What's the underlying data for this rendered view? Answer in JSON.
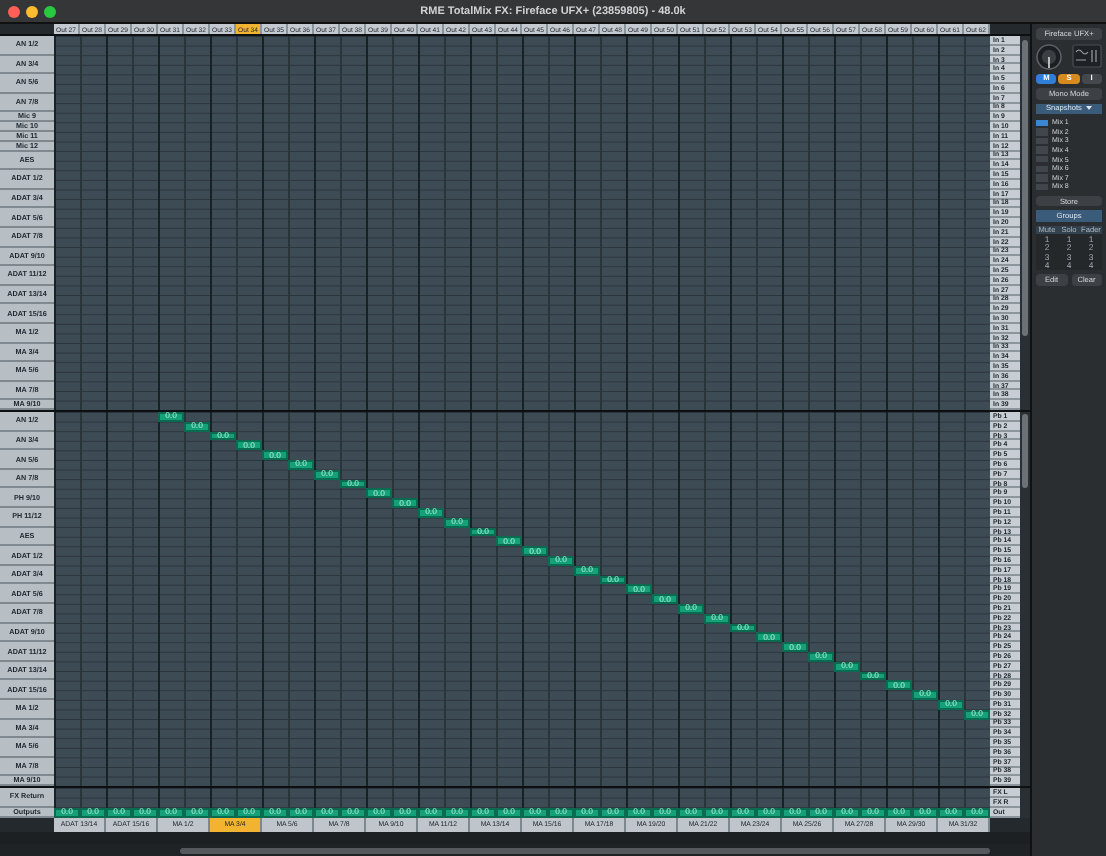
{
  "window": {
    "title": "RME TotalMix FX: Fireface UFX+ (23859805) - 48.0k"
  },
  "hardware_outputs": [
    {
      "label": "Out 27",
      "selected": false,
      "gain": "0.0"
    },
    {
      "label": "Out 28",
      "selected": false,
      "gain": "0.0"
    },
    {
      "label": "Out 29",
      "selected": false,
      "gain": "0.0"
    },
    {
      "label": "Out 30",
      "selected": false,
      "gain": "0.0"
    },
    {
      "label": "Out 31",
      "selected": false,
      "gain": "0.0"
    },
    {
      "label": "Out 32",
      "selected": false,
      "gain": "0.0"
    },
    {
      "label": "Out 33",
      "selected": false,
      "gain": "0.0"
    },
    {
      "label": "Out 34",
      "selected": true,
      "gain": "0.0"
    },
    {
      "label": "Out 35",
      "selected": false,
      "gain": "0.0"
    },
    {
      "label": "Out 36",
      "selected": false,
      "gain": "0.0"
    },
    {
      "label": "Out 37",
      "selected": false,
      "gain": "0.0"
    },
    {
      "label": "Out 38",
      "selected": false,
      "gain": "0.0"
    },
    {
      "label": "Out 39",
      "selected": false,
      "gain": "0.0"
    },
    {
      "label": "Out 40",
      "selected": false,
      "gain": "0.0"
    },
    {
      "label": "Out 41",
      "selected": false,
      "gain": "0.0"
    },
    {
      "label": "Out 42",
      "selected": false,
      "gain": "0.0"
    },
    {
      "label": "Out 43",
      "selected": false,
      "gain": "0.0"
    },
    {
      "label": "Out 44",
      "selected": false,
      "gain": "0.0"
    },
    {
      "label": "Out 45",
      "selected": false,
      "gain": "0.0"
    },
    {
      "label": "Out 46",
      "selected": false,
      "gain": "0.0"
    },
    {
      "label": "Out 47",
      "selected": false,
      "gain": "0.0"
    },
    {
      "label": "Out 48",
      "selected": false,
      "gain": "0.0"
    },
    {
      "label": "Out 49",
      "selected": false,
      "gain": "0.0"
    },
    {
      "label": "Out 50",
      "selected": false,
      "gain": "0.0"
    },
    {
      "label": "Out 51",
      "selected": false,
      "gain": "0.0"
    },
    {
      "label": "Out 52",
      "selected": false,
      "gain": "0.0"
    },
    {
      "label": "Out 53",
      "selected": false,
      "gain": "0.0"
    },
    {
      "label": "Out 54",
      "selected": false,
      "gain": "0.0"
    },
    {
      "label": "Out 55",
      "selected": false,
      "gain": "0.0"
    },
    {
      "label": "Out 56",
      "selected": false,
      "gain": "0.0"
    },
    {
      "label": "Out 57",
      "selected": false,
      "gain": "0.0"
    },
    {
      "label": "Out 58",
      "selected": false,
      "gain": "0.0"
    },
    {
      "label": "Out 59",
      "selected": false,
      "gain": "0.0"
    },
    {
      "label": "Out 60",
      "selected": false,
      "gain": "0.0"
    },
    {
      "label": "Out 61",
      "selected": false,
      "gain": "0.0"
    },
    {
      "label": "Out 62",
      "selected": false,
      "gain": "0.0"
    }
  ],
  "output_pairs": [
    {
      "label": "ADAT 13/14",
      "selected": false
    },
    {
      "label": "ADAT 15/16",
      "selected": false
    },
    {
      "label": "MA 1/2",
      "selected": false
    },
    {
      "label": "MA 3/4",
      "selected": true
    },
    {
      "label": "MA 5/6",
      "selected": false
    },
    {
      "label": "MA 7/8",
      "selected": false
    },
    {
      "label": "MA 9/10",
      "selected": false
    },
    {
      "label": "MA 11/12",
      "selected": false
    },
    {
      "label": "MA 13/14",
      "selected": false
    },
    {
      "label": "MA 15/16",
      "selected": false
    },
    {
      "label": "MA 17/18",
      "selected": false
    },
    {
      "label": "MA 19/20",
      "selected": false
    },
    {
      "label": "MA 21/22",
      "selected": false
    },
    {
      "label": "MA 23/24",
      "selected": false
    },
    {
      "label": "MA 25/26",
      "selected": false
    },
    {
      "label": "MA 27/28",
      "selected": false
    },
    {
      "label": "MA 29/30",
      "selected": false
    },
    {
      "label": "MA 31/32",
      "selected": false
    }
  ],
  "inputs": {
    "channels": [
      {
        "label": "AN 1/2",
        "kind": "stereo"
      },
      {
        "label": "AN 3/4",
        "kind": "stereo"
      },
      {
        "label": "AN 5/6",
        "kind": "stereo"
      },
      {
        "label": "AN 7/8",
        "kind": "stereo"
      },
      {
        "label": "Mic 9",
        "kind": "mono"
      },
      {
        "label": "Mic 10",
        "kind": "mono"
      },
      {
        "label": "Mic 11",
        "kind": "mono"
      },
      {
        "label": "Mic 12",
        "kind": "mono"
      },
      {
        "label": "AES",
        "kind": "stereo"
      },
      {
        "label": "ADAT 1/2",
        "kind": "stereo"
      },
      {
        "label": "ADAT 3/4",
        "kind": "stereo"
      },
      {
        "label": "ADAT 5/6",
        "kind": "stereo"
      },
      {
        "label": "ADAT 7/8",
        "kind": "stereo"
      },
      {
        "label": "ADAT 9/10",
        "kind": "stereo"
      },
      {
        "label": "ADAT 11/12",
        "kind": "stereo"
      },
      {
        "label": "ADAT 13/14",
        "kind": "stereo"
      },
      {
        "label": "ADAT 15/16",
        "kind": "stereo"
      },
      {
        "label": "MA 1/2",
        "kind": "stereo"
      },
      {
        "label": "MA 3/4",
        "kind": "stereo"
      },
      {
        "label": "MA 5/6",
        "kind": "stereo"
      },
      {
        "label": "MA 7/8",
        "kind": "stereo"
      },
      {
        "label": "MA 9/10",
        "kind": "mono"
      }
    ],
    "rows": [
      {
        "label": "In 1"
      },
      {
        "label": "In 2"
      },
      {
        "label": "In 3"
      },
      {
        "label": "In 4"
      },
      {
        "label": "In 5"
      },
      {
        "label": "In 6"
      },
      {
        "label": "In 7"
      },
      {
        "label": "In 8"
      },
      {
        "label": "In 9"
      },
      {
        "label": "In 10"
      },
      {
        "label": "In 11"
      },
      {
        "label": "In 12"
      },
      {
        "label": "In 13"
      },
      {
        "label": "In 14"
      },
      {
        "label": "In 15"
      },
      {
        "label": "In 16"
      },
      {
        "label": "In 17"
      },
      {
        "label": "In 18"
      },
      {
        "label": "In 19"
      },
      {
        "label": "In 20"
      },
      {
        "label": "In 21"
      },
      {
        "label": "In 22"
      },
      {
        "label": "In 23"
      },
      {
        "label": "In 24"
      },
      {
        "label": "In 25"
      },
      {
        "label": "In 26"
      },
      {
        "label": "In 27"
      },
      {
        "label": "In 28"
      },
      {
        "label": "In 29"
      },
      {
        "label": "In 30"
      },
      {
        "label": "In 31"
      },
      {
        "label": "In 32"
      },
      {
        "label": "In 33"
      },
      {
        "label": "In 34"
      },
      {
        "label": "In 35"
      },
      {
        "label": "In 36"
      },
      {
        "label": "In 37"
      },
      {
        "label": "In 38"
      },
      {
        "label": "In 39"
      }
    ]
  },
  "playback": {
    "channels": [
      {
        "label": "AN 1/2",
        "kind": "stereo"
      },
      {
        "label": "AN 3/4",
        "kind": "stereo"
      },
      {
        "label": "AN 5/6",
        "kind": "stereo"
      },
      {
        "label": "AN 7/8",
        "kind": "stereo"
      },
      {
        "label": "PH 9/10",
        "kind": "stereo"
      },
      {
        "label": "PH 11/12",
        "kind": "stereo"
      },
      {
        "label": "AES",
        "kind": "stereo"
      },
      {
        "label": "ADAT 1/2",
        "kind": "stereo"
      },
      {
        "label": "ADAT 3/4",
        "kind": "stereo"
      },
      {
        "label": "ADAT 5/6",
        "kind": "stereo"
      },
      {
        "label": "ADAT 7/8",
        "kind": "stereo"
      },
      {
        "label": "ADAT 9/10",
        "kind": "stereo"
      },
      {
        "label": "ADAT 11/12",
        "kind": "stereo"
      },
      {
        "label": "ADAT 13/14",
        "kind": "stereo"
      },
      {
        "label": "ADAT 15/16",
        "kind": "stereo"
      },
      {
        "label": "MA 1/2",
        "kind": "stereo"
      },
      {
        "label": "MA 3/4",
        "kind": "stereo"
      },
      {
        "label": "MA 5/6",
        "kind": "stereo"
      },
      {
        "label": "MA 7/8",
        "kind": "stereo"
      },
      {
        "label": "MA 9/10",
        "kind": "mono"
      }
    ],
    "rows": [
      {
        "label": "Pb 1",
        "gain": "0.0"
      },
      {
        "label": "Pb 2",
        "gain": "0.0"
      },
      {
        "label": "Pb 3",
        "gain": "0.0"
      },
      {
        "label": "Pb 4",
        "gain": "0.0"
      },
      {
        "label": "Pb 5",
        "gain": "0.0"
      },
      {
        "label": "Pb 6",
        "gain": "0.0"
      },
      {
        "label": "Pb 7",
        "gain": "0.0"
      },
      {
        "label": "Pb 8",
        "gain": "0.0"
      },
      {
        "label": "Pb 9",
        "gain": "0.0"
      },
      {
        "label": "Pb 10",
        "gain": "0.0"
      },
      {
        "label": "Pb 11",
        "gain": "0.0"
      },
      {
        "label": "Pb 12",
        "gain": "0.0"
      },
      {
        "label": "Pb 13",
        "gain": "0.0"
      },
      {
        "label": "Pb 14",
        "gain": "0.0"
      },
      {
        "label": "Pb 15",
        "gain": "0.0"
      },
      {
        "label": "Pb 16",
        "gain": "0.0"
      },
      {
        "label": "Pb 17",
        "gain": "0.0"
      },
      {
        "label": "Pb 18",
        "gain": "0.0"
      },
      {
        "label": "Pb 19",
        "gain": "0.0"
      },
      {
        "label": "Pb 20",
        "gain": "0.0"
      },
      {
        "label": "Pb 21",
        "gain": "0.0"
      },
      {
        "label": "Pb 22",
        "gain": "0.0"
      },
      {
        "label": "Pb 23",
        "gain": "0.0"
      },
      {
        "label": "Pb 24",
        "gain": "0.0"
      },
      {
        "label": "Pb 25",
        "gain": "0.0"
      },
      {
        "label": "Pb 26",
        "gain": "0.0"
      },
      {
        "label": "Pb 27",
        "gain": "0.0"
      },
      {
        "label": "Pb 28",
        "gain": "0.0"
      },
      {
        "label": "Pb 29",
        "gain": "0.0"
      },
      {
        "label": "Pb 30",
        "gain": "0.0"
      },
      {
        "label": "Pb 31",
        "gain": "0.0"
      },
      {
        "label": "Pb 32",
        "gain": "0.0"
      },
      {
        "label": "Pb 33"
      },
      {
        "label": "Pb 34"
      },
      {
        "label": "Pb 35"
      },
      {
        "label": "Pb 36"
      },
      {
        "label": "Pb 37"
      },
      {
        "label": "Pb 38"
      },
      {
        "label": "Pb 39"
      }
    ]
  },
  "buses": {
    "channels": [
      {
        "label": "FX Return",
        "kind": "stereo"
      },
      {
        "label": "Outputs",
        "kind": "mono"
      }
    ],
    "rows": [
      {
        "label": "FX L",
        "kind": "bus"
      },
      {
        "label": "FX R",
        "kind": "bus"
      },
      {
        "label": "Out",
        "kind": "outputs"
      }
    ]
  },
  "sidebar": {
    "device": "Fireface UFX+",
    "buttons": [
      {
        "label": "M",
        "color": "#2f7fd8"
      },
      {
        "label": "S",
        "color": "#d98a1f"
      },
      {
        "label": "I",
        "color": "#45494d"
      }
    ],
    "mono_mode": "Mono Mode",
    "snapshots": {
      "title": "Snapshots",
      "items": [
        {
          "label": "Mix 1",
          "selected": true
        },
        {
          "label": "Mix 2",
          "selected": false
        },
        {
          "label": "Mix 3",
          "selected": false
        },
        {
          "label": "Mix 4",
          "selected": false
        },
        {
          "label": "Mix 5",
          "selected": false
        },
        {
          "label": "Mix 6",
          "selected": false
        },
        {
          "label": "Mix 7",
          "selected": false
        },
        {
          "label": "Mix 8",
          "selected": false
        }
      ],
      "store": "Store"
    },
    "groups": {
      "title": "Groups",
      "columns": [
        {
          "label": "Mute",
          "values": [
            "1",
            "2",
            "3",
            "4"
          ]
        },
        {
          "label": "Solo",
          "values": [
            "1",
            "2",
            "3",
            "4"
          ]
        },
        {
          "label": "Fader",
          "values": [
            "1",
            "2",
            "3",
            "4"
          ]
        }
      ],
      "buttons": [
        "Edit",
        "Clear"
      ]
    }
  }
}
